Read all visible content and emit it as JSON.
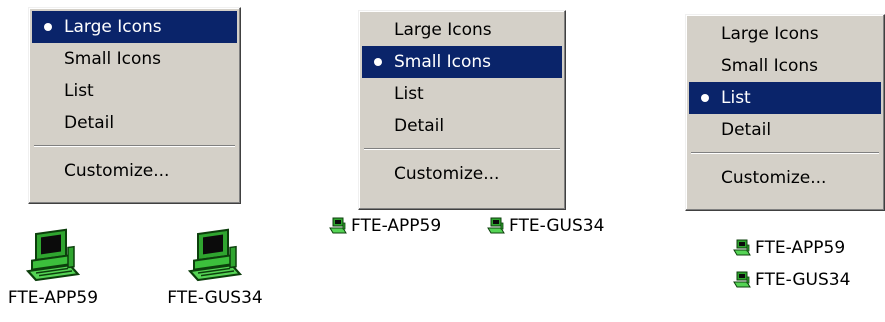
{
  "menus": [
    {
      "items": [
        "Large Icons",
        "Small Icons",
        "List",
        "Detail"
      ],
      "selected_index": 0,
      "customize_label": "Customize..."
    },
    {
      "items": [
        "Large Icons",
        "Small Icons",
        "List",
        "Detail"
      ],
      "selected_index": 1,
      "customize_label": "Customize..."
    },
    {
      "items": [
        "Large Icons",
        "Small Icons",
        "List",
        "Detail"
      ],
      "selected_index": 2,
      "customize_label": "Customize..."
    }
  ],
  "computers": [
    "FTE-APP59",
    "FTE-GUS34"
  ],
  "icon": "computer-icon",
  "colors": {
    "menu_bg": "#d4d0c8",
    "highlight": "#0a246a",
    "highlight_text": "#ffffff",
    "icon_green": "#2fa52f"
  }
}
